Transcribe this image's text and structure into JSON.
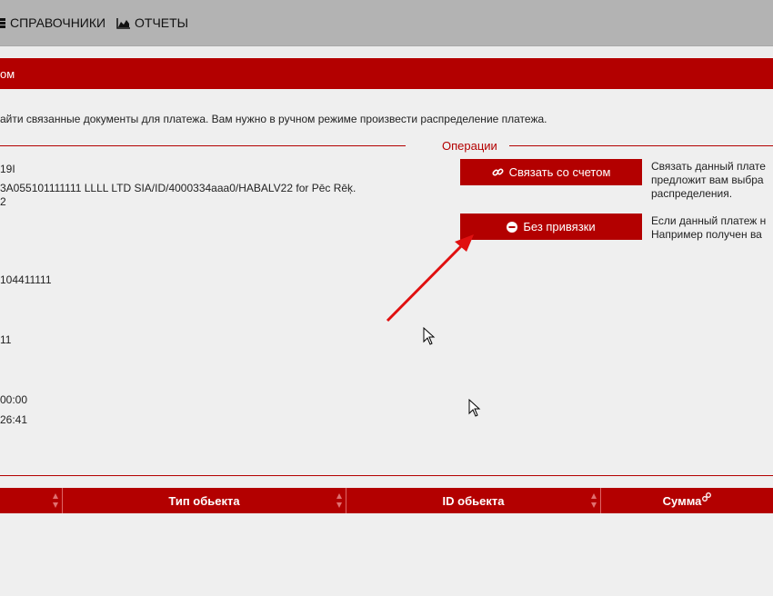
{
  "nav": {
    "directories": "СПРАВОЧНИКИ",
    "reports": "ОТЧЕТЫ"
  },
  "header": {
    "title": "ом"
  },
  "info": "айти связанные документы для платежа. Вам нужно в ручном режиме произвести распределение платежа.",
  "operations": {
    "legend": "Операции",
    "link_label": "Связать со счетом",
    "link_desc": [
      "Связать данный плате",
      "предложит вам выбра",
      "распределения."
    ],
    "nolink_label": "Без привязки",
    "nolink_desc": [
      "Если данный платеж н",
      "Например получен ва"
    ]
  },
  "fields": [
    "19I",
    "3A055101111111 LLLL LTD SIA/ID/4000334aaa0/HABALV22 for Pēc Rēķ.",
    "2",
    "104411111",
    "11",
    "00:00",
    "26:41"
  ],
  "table": {
    "columns": [
      "",
      "Тип обьекта",
      "ID обьекта",
      "Сумма"
    ]
  },
  "colors": {
    "accent": "#b30000",
    "topbar": "#b3b3b3",
    "background": "#efefef"
  }
}
